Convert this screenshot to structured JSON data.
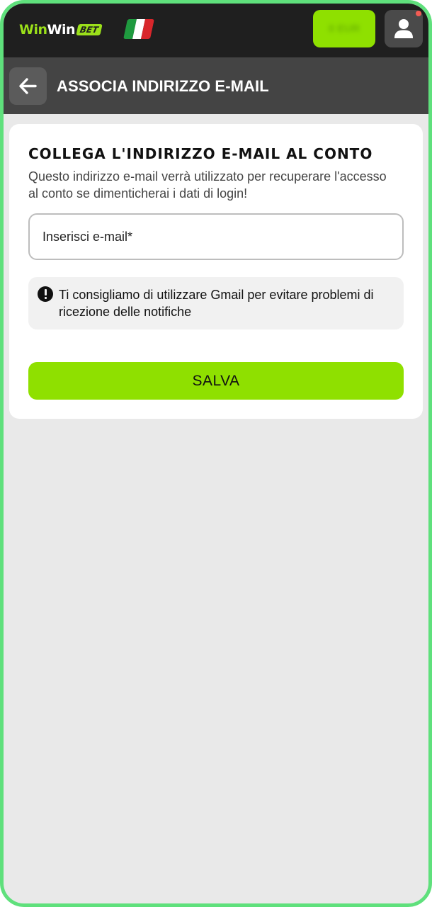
{
  "header": {
    "logo": {
      "part1": "Win",
      "part2": "Win",
      "badge": "BET"
    },
    "flag": "italy-flag",
    "balance_label": "0 EUR",
    "user_icon": "user-icon"
  },
  "subheader": {
    "back_icon": "arrow-left-icon",
    "title": "ASSOCIA INDIRIZZO E-MAIL"
  },
  "card": {
    "title": "COLLEGA L'INDIRIZZO E-MAIL AL CONTO",
    "description": "Questo indirizzo e-mail verrà utilizzato per recuperare l'accesso al conto se dimenticherai i dati di login!",
    "email_input": {
      "placeholder": "Inserisci e-mail*",
      "value": ""
    },
    "hint": {
      "icon": "exclamation-circle-icon",
      "text": "Ti consigliamo di utilizzare Gmail per evitare problemi di ricezione delle notifiche"
    },
    "save_label": "SALVA"
  },
  "colors": {
    "accent_green": "#8fe000",
    "header_bg": "#1f1f1f",
    "subheader_bg": "#444444",
    "frame_border": "#5fe07c",
    "page_bg": "#e9e9e9"
  }
}
